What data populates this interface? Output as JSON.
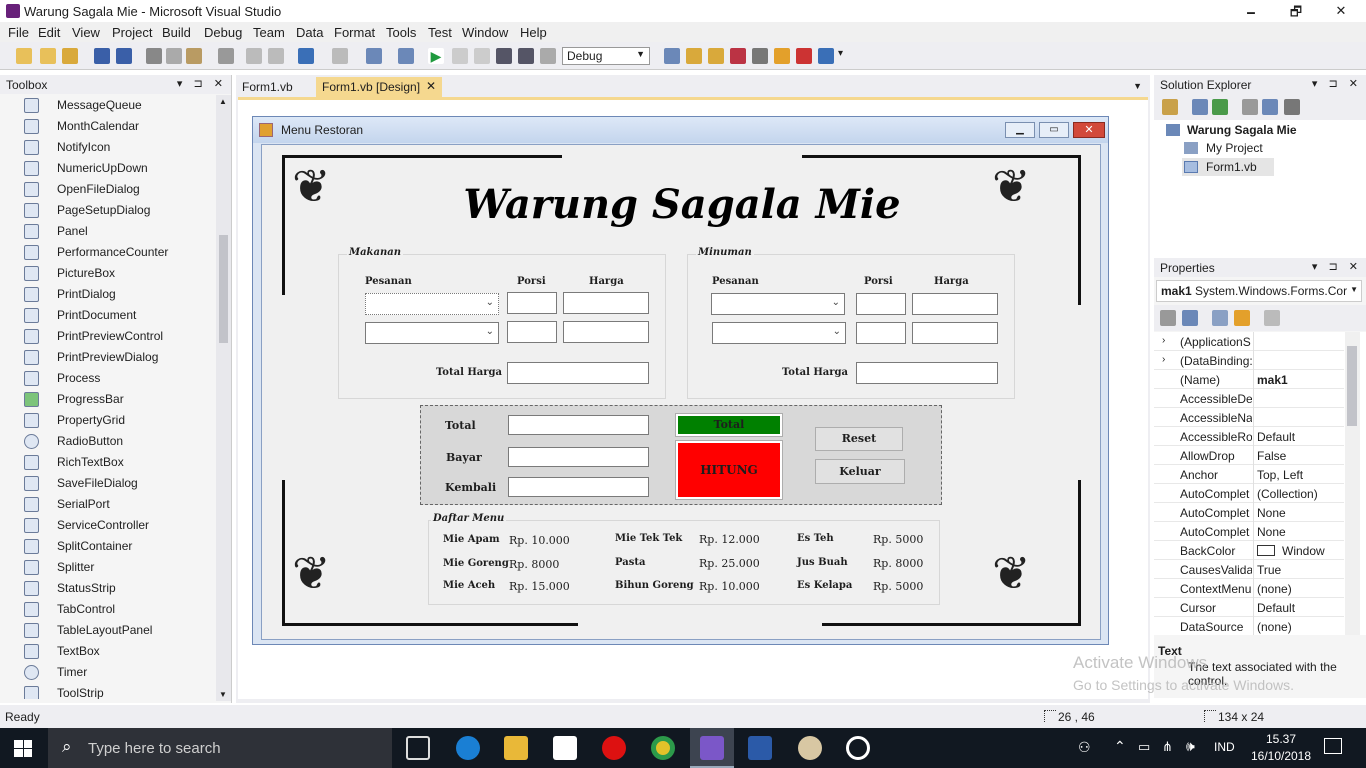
{
  "window": {
    "title": "Warung Sagala Mie - Microsoft Visual Studio",
    "minimize": "🗕",
    "maximize": "🗗",
    "close": "✕"
  },
  "menu": [
    "File",
    "Edit",
    "View",
    "Project",
    "Build",
    "Debug",
    "Team",
    "Data",
    "Format",
    "Tools",
    "Test",
    "Window",
    "Help"
  ],
  "toolbar": {
    "config": "Debug"
  },
  "toolbox": {
    "title": "Toolbox",
    "items": [
      "MessageQueue",
      "MonthCalendar",
      "NotifyIcon",
      "NumericUpDown",
      "OpenFileDialog",
      "PageSetupDialog",
      "Panel",
      "PerformanceCounter",
      "PictureBox",
      "PrintDialog",
      "PrintDocument",
      "PrintPreviewControl",
      "PrintPreviewDialog",
      "Process",
      "ProgressBar",
      "PropertyGrid",
      "RadioButton",
      "RichTextBox",
      "SaveFileDialog",
      "SerialPort",
      "ServiceController",
      "SplitContainer",
      "Splitter",
      "StatusStrip",
      "TabControl",
      "TableLayoutPanel",
      "TextBox",
      "Timer",
      "ToolStrip"
    ]
  },
  "tabs": [
    {
      "label": "Form1.vb"
    },
    {
      "label": "Form1.vb [Design]"
    }
  ],
  "form": {
    "title": "Menu Restoran",
    "heading": "Warung Sagala Mie",
    "makanan": {
      "title": "Makanan",
      "pesanan": "Pesanan",
      "porsi": "Porsi",
      "harga": "Harga",
      "total": "Total Harga"
    },
    "minuman": {
      "title": "Minuman",
      "pesanan": "Pesanan",
      "porsi": "Porsi",
      "harga": "Harga",
      "total": "Total Harga"
    },
    "pay": {
      "total": "Total",
      "bayar": "Bayar",
      "kembali": "Kembali",
      "btn_total": "Total",
      "btn_hitung": "HITUNG",
      "btn_reset": "Reset",
      "btn_keluar": "Keluar"
    },
    "daftar": {
      "title": "Daftar Menu",
      "items": [
        {
          "name": "Mie Apam",
          "price": "Rp. 10.000"
        },
        {
          "name": "Mie Goreng",
          "price": "Rp. 8000"
        },
        {
          "name": "Mie Aceh",
          "price": "Rp. 15.000"
        },
        {
          "name": "Mie Tek Tek",
          "price": "Rp. 12.000"
        },
        {
          "name": "Pasta",
          "price": "Rp. 25.000"
        },
        {
          "name": "Bihun Goreng",
          "price": "Rp. 10.000"
        },
        {
          "name": "Es Teh",
          "price": "Rp. 5000"
        },
        {
          "name": "Jus Buah",
          "price": "Rp. 8000"
        },
        {
          "name": "Es Kelapa",
          "price": "Rp. 5000"
        }
      ]
    },
    "colors": {
      "total_btn": "#008000",
      "hitung_btn": "#ff0000"
    }
  },
  "solution": {
    "title": "Solution Explorer",
    "root": "Warung Sagala Mie",
    "children": [
      "My Project",
      "Form1.vb"
    ]
  },
  "properties": {
    "title": "Properties",
    "object": "mak1",
    "type": "System.Windows.Forms.Cor",
    "rows": [
      {
        "n": "(ApplicationS",
        "v": ""
      },
      {
        "n": "(DataBinding:",
        "v": ""
      },
      {
        "n": "(Name)",
        "v": "mak1"
      },
      {
        "n": "AccessibleDes",
        "v": ""
      },
      {
        "n": "AccessibleNa",
        "v": ""
      },
      {
        "n": "AccessibleRol",
        "v": "Default"
      },
      {
        "n": "AllowDrop",
        "v": "False"
      },
      {
        "n": "Anchor",
        "v": "Top, Left"
      },
      {
        "n": "AutoComplet",
        "v": "(Collection)"
      },
      {
        "n": "AutoComplet",
        "v": "None"
      },
      {
        "n": "AutoComplet",
        "v": "None"
      },
      {
        "n": "BackColor",
        "v": "Window"
      },
      {
        "n": "CausesValidat",
        "v": "True"
      },
      {
        "n": "ContextMenu",
        "v": "(none)"
      },
      {
        "n": "Cursor",
        "v": "Default"
      },
      {
        "n": "DataSource",
        "v": "(none)"
      }
    ],
    "desc_title": "Text",
    "desc": "The text associated with the control."
  },
  "watermark": {
    "line1": "Activate Windows",
    "line2": "Go to Settings to activate Windows."
  },
  "status": {
    "ready": "Ready",
    "pos": "26 , 46",
    "size": "134 x 24"
  },
  "taskbar": {
    "search": "Type here to search",
    "lang": "IND",
    "time": "15.37",
    "date": "16/10/2018"
  }
}
